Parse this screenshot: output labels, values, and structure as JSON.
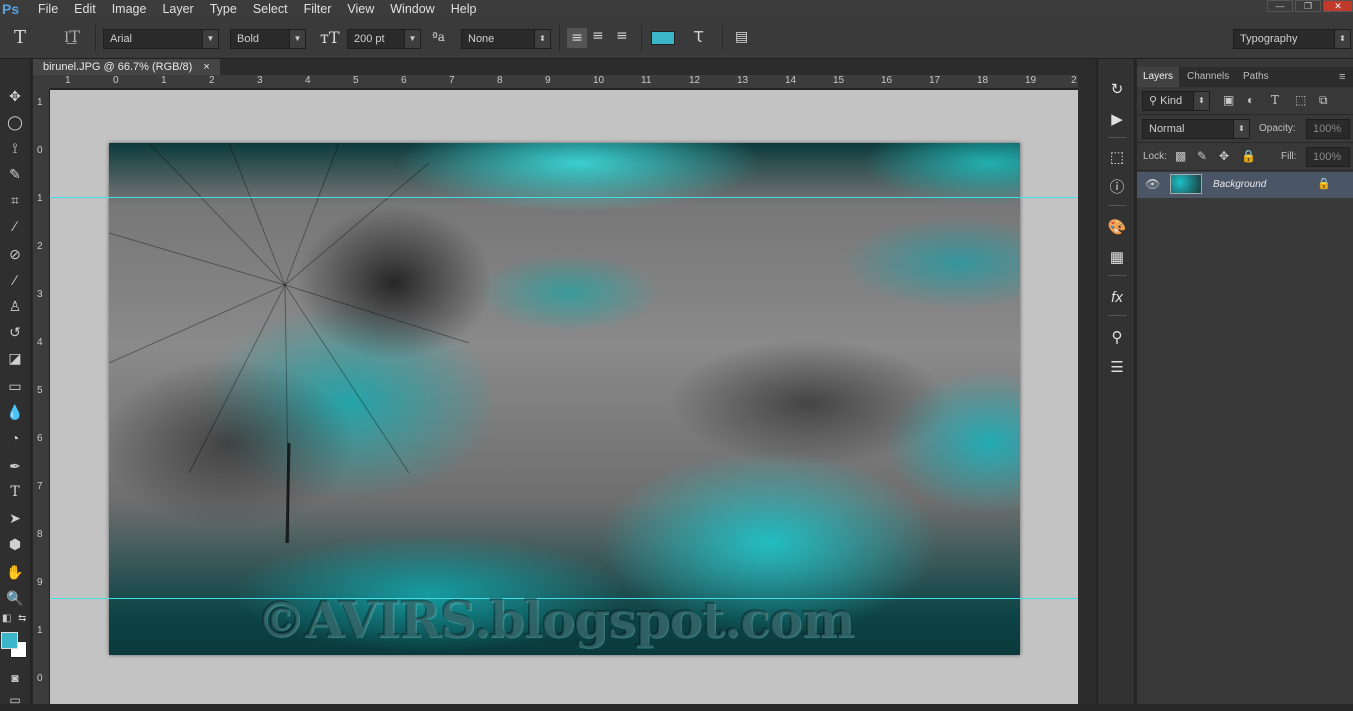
{
  "app": {
    "logo": "Ps"
  },
  "menu": [
    "File",
    "Edit",
    "Image",
    "Layer",
    "Type",
    "Select",
    "Filter",
    "View",
    "Window",
    "Help"
  ],
  "window_controls": {
    "minimize": "—",
    "restore": "❐",
    "close": "✕"
  },
  "options": {
    "font_family": "Arial",
    "font_style": "Bold",
    "font_size": "200 pt",
    "anti_alias": "None",
    "text_color": "#3ab6c8",
    "workspace": "Typography"
  },
  "document": {
    "tab_title": "birunel.JPG @ 66.7% (RGB/8)",
    "close": "×",
    "ruler_h": [
      "1",
      "0",
      "1",
      "2",
      "3",
      "4",
      "5",
      "6",
      "7",
      "8",
      "9",
      "10",
      "11",
      "12",
      "13",
      "14",
      "15",
      "16",
      "17",
      "18",
      "19",
      "2"
    ],
    "ruler_v": [
      "1",
      "0",
      "1",
      "2",
      "3",
      "4",
      "5",
      "6",
      "7",
      "8",
      "9",
      "1",
      "0",
      "1"
    ],
    "watermark": "©AVIRS.blogspot.com"
  },
  "layers_panel": {
    "tabs": [
      "Layers",
      "Channels",
      "Paths"
    ],
    "filter_kind": "Kind",
    "blend_mode": "Normal",
    "opacity_label": "Opacity:",
    "opacity_value": "100%",
    "lock_label": "Lock:",
    "fill_label": "Fill:",
    "fill_value": "100%",
    "layers": [
      {
        "name": "Background",
        "visible": true,
        "locked": true
      }
    ]
  },
  "colors": {
    "accent_cyan": "#3fe0e8",
    "foreground_swatch": "#3ab6c8",
    "background_swatch": "#ffffff"
  }
}
